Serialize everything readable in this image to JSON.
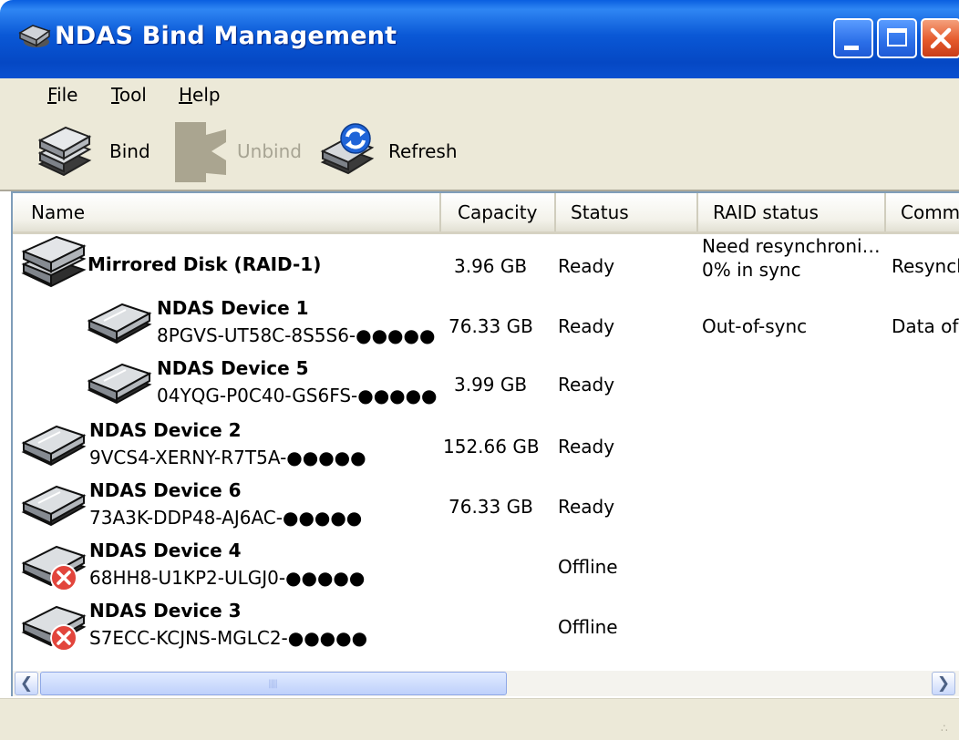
{
  "window": {
    "title": "NDAS Bind Management",
    "icon": "ndas-app-icon",
    "controls": [
      "minimize",
      "maximize",
      "close"
    ]
  },
  "menu": {
    "file": {
      "label": "File",
      "accel": "F",
      "rest": "ile"
    },
    "tool": {
      "label": "Tool",
      "accel": "T",
      "rest": "ool"
    },
    "help": {
      "label": "Help",
      "accel": "H",
      "rest": "elp"
    }
  },
  "toolbar": {
    "bind": {
      "label": "Bind",
      "icon": "bind-icon",
      "enabled": true
    },
    "unbind": {
      "label": "Unbind",
      "icon": "unbind-icon",
      "enabled": false
    },
    "refresh": {
      "label": "Refresh",
      "icon": "refresh-icon",
      "enabled": true
    }
  },
  "columns": {
    "name": "Name",
    "capacity": "Capacity",
    "status": "Status",
    "raid_status": "RAID status",
    "comment": "Comme"
  },
  "rows": [
    {
      "name": "Mirrored Disk (RAID-1)",
      "id": "",
      "capacity": "3.96 GB",
      "status": "Ready",
      "raid_line1": "Need resynchroni…",
      "raid_line2": "0% in sync",
      "comment": "Resynch",
      "icon": "raid-disk-icon"
    },
    {
      "name": "NDAS Device 1",
      "id": "8PGVS-UT58C-8S5S6-●●●●●",
      "capacity": "76.33 GB",
      "status": "Ready",
      "raid_line1": "Out-of-sync",
      "raid_line2": "",
      "comment": "Data of",
      "icon": "disk-icon"
    },
    {
      "name": "NDAS Device 5",
      "id": "04YQG-P0C40-GS6FS-●●●●●",
      "capacity": "3.99 GB",
      "status": "Ready",
      "raid_line1": "",
      "raid_line2": "",
      "comment": "",
      "icon": "disk-icon"
    },
    {
      "name": "NDAS Device 2",
      "id": "9VCS4-XERNY-R7T5A-●●●●●",
      "capacity": "152.66 GB",
      "status": "Ready",
      "raid_line1": "",
      "raid_line2": "",
      "comment": "",
      "icon": "disk-icon"
    },
    {
      "name": "NDAS Device 6",
      "id": "73A3K-DDP48-AJ6AC-●●●●●",
      "capacity": "76.33 GB",
      "status": "Ready",
      "raid_line1": "",
      "raid_line2": "",
      "comment": "",
      "icon": "disk-icon"
    },
    {
      "name": "NDAS Device 4",
      "id": "68HH8-U1KP2-ULGJ0-●●●●●",
      "capacity": "",
      "status": "Offline",
      "raid_line1": "",
      "raid_line2": "",
      "comment": "",
      "icon": "disk-offline-icon"
    },
    {
      "name": "NDAS Device 3",
      "id": "S7ECC-KCJNS-MGLC2-●●●●●",
      "capacity": "",
      "status": "Offline",
      "raid_line1": "",
      "raid_line2": "",
      "comment": "",
      "icon": "disk-offline-icon"
    }
  ],
  "colors": {
    "titlebar": "#0a58d6",
    "chrome": "#ece9d8",
    "list_border": "#7f9db9",
    "close_button": "#e55a2c",
    "offline_badge": "#e2453c"
  }
}
